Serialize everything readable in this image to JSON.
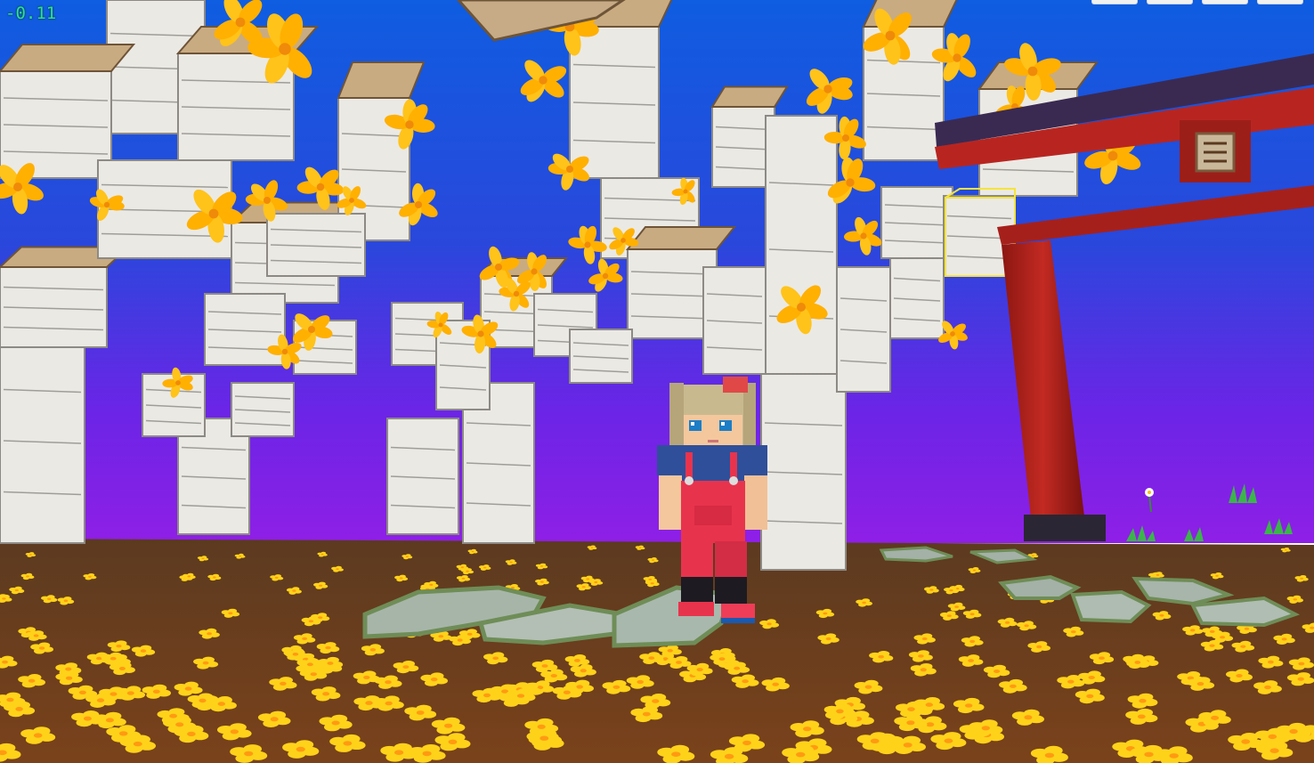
{
  "hud": {
    "fps_readout": "-0.11",
    "top_buttons": [
      "menu-1",
      "menu-2",
      "menu-3",
      "menu-4"
    ]
  },
  "colors": {
    "sky_top": "#0f5de0",
    "sky_mid": "#3a3fd6",
    "sky_bottom": "#8a1fe8",
    "ground": "#6b3d1d",
    "flower": "#ffd21a",
    "birch": "#e8e6e1",
    "torii": "#b8231f",
    "stone": "#9fb0a6",
    "overalls": "#e8334d",
    "shirt": "#2f4f9a",
    "hair": "#c9b98f"
  }
}
